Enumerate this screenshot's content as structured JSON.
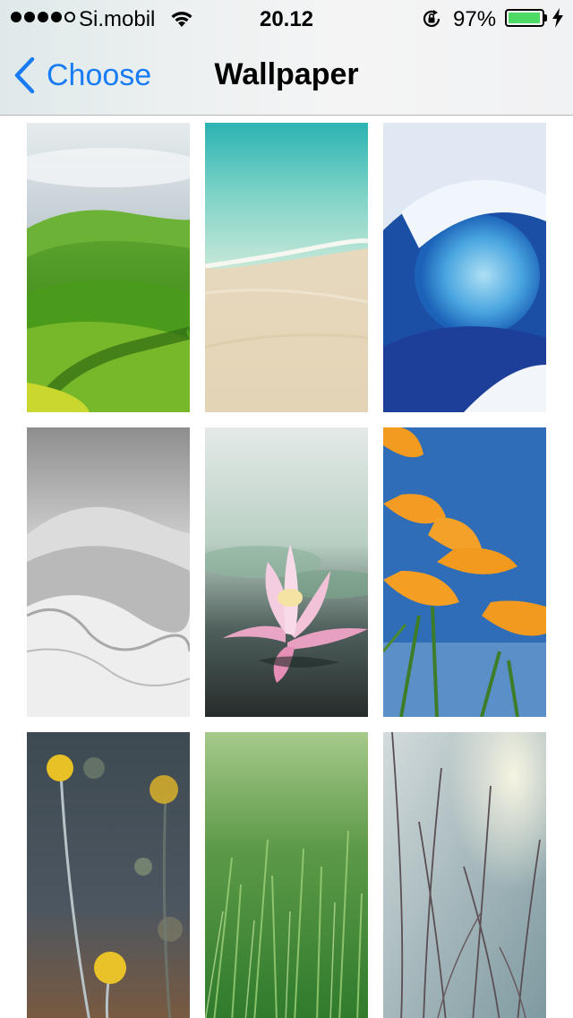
{
  "status_bar": {
    "signal_bars_filled": 4,
    "signal_bars_total": 5,
    "carrier": "Si.mobil",
    "time": "20.12",
    "battery_percent": "97%",
    "battery_level": 0.97,
    "battery_color": "#4cd964",
    "icons": [
      "wifi-icon",
      "rotation-lock-icon",
      "battery-icon",
      "charging-bolt-icon"
    ]
  },
  "navbar": {
    "back_label": "Choose",
    "title": "Wallpaper",
    "accent_color": "#1a7cf5"
  },
  "wallpapers": [
    {
      "name": "green-hills"
    },
    {
      "name": "beach-shore"
    },
    {
      "name": "ocean-wave-blue"
    },
    {
      "name": "ocean-wave-bw"
    },
    {
      "name": "lotus-flower"
    },
    {
      "name": "orange-poppies"
    },
    {
      "name": "yellow-billy-buttons"
    },
    {
      "name": "green-grass-dew"
    },
    {
      "name": "grass-stems-light"
    }
  ]
}
